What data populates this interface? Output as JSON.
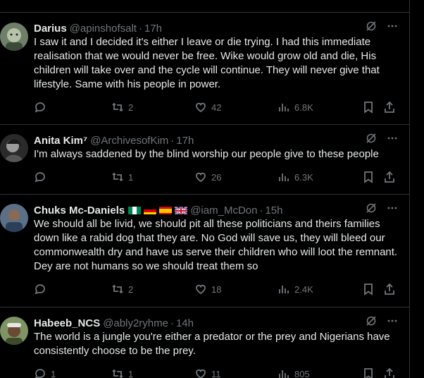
{
  "tweets": [
    {
      "name": "Darius",
      "handle": "@apinshofsalt",
      "time": "17h",
      "text": "I saw it and I decided it's either I leave or die trying. I had this immediate realisation that we would never be free. Wike would grow old and die, His children will take over and the cycle will continue. They will never give that lifestyle. Same with his people in power.",
      "replies": "",
      "reposts": "2",
      "likes": "42",
      "views": "6.8K"
    },
    {
      "name": "Anita Kim⁷",
      "handle": "@ArchivesofKim",
      "time": "17h",
      "text": "I'm always saddened by the blind worship our people give to these people",
      "replies": "",
      "reposts": "1",
      "likes": "26",
      "views": "6.3K"
    },
    {
      "name": "Chuks Mc-Daniels",
      "handle": "@iam_McDon",
      "time": "15h",
      "flags": [
        "nigeria-flag",
        "germany-flag",
        "spain-flag",
        "uk-flag"
      ],
      "text": "We should all be livid, we should pit all these politicians and theirs families down like a rabid dog that they are. No God will save us, they will bleed our commonwealth dry and have us serve their children who will loot the remnant. Dey are not humans so we should treat them so",
      "replies": "",
      "reposts": "2",
      "likes": "18",
      "views": "2.4K"
    },
    {
      "name": "Habeeb_NCS",
      "handle": "@ably2ryhme",
      "time": "14h",
      "text": "The world is a jungle you're either a predator or the prey and Nigerians have consistently choose to be the prey.",
      "replies": "1",
      "reposts": "1",
      "likes": "11",
      "views": "805"
    }
  ],
  "separator": "·",
  "colors": {
    "background": "#000000",
    "text": "#e7e9ea",
    "muted": "#71767b",
    "border": "#2f3336"
  }
}
